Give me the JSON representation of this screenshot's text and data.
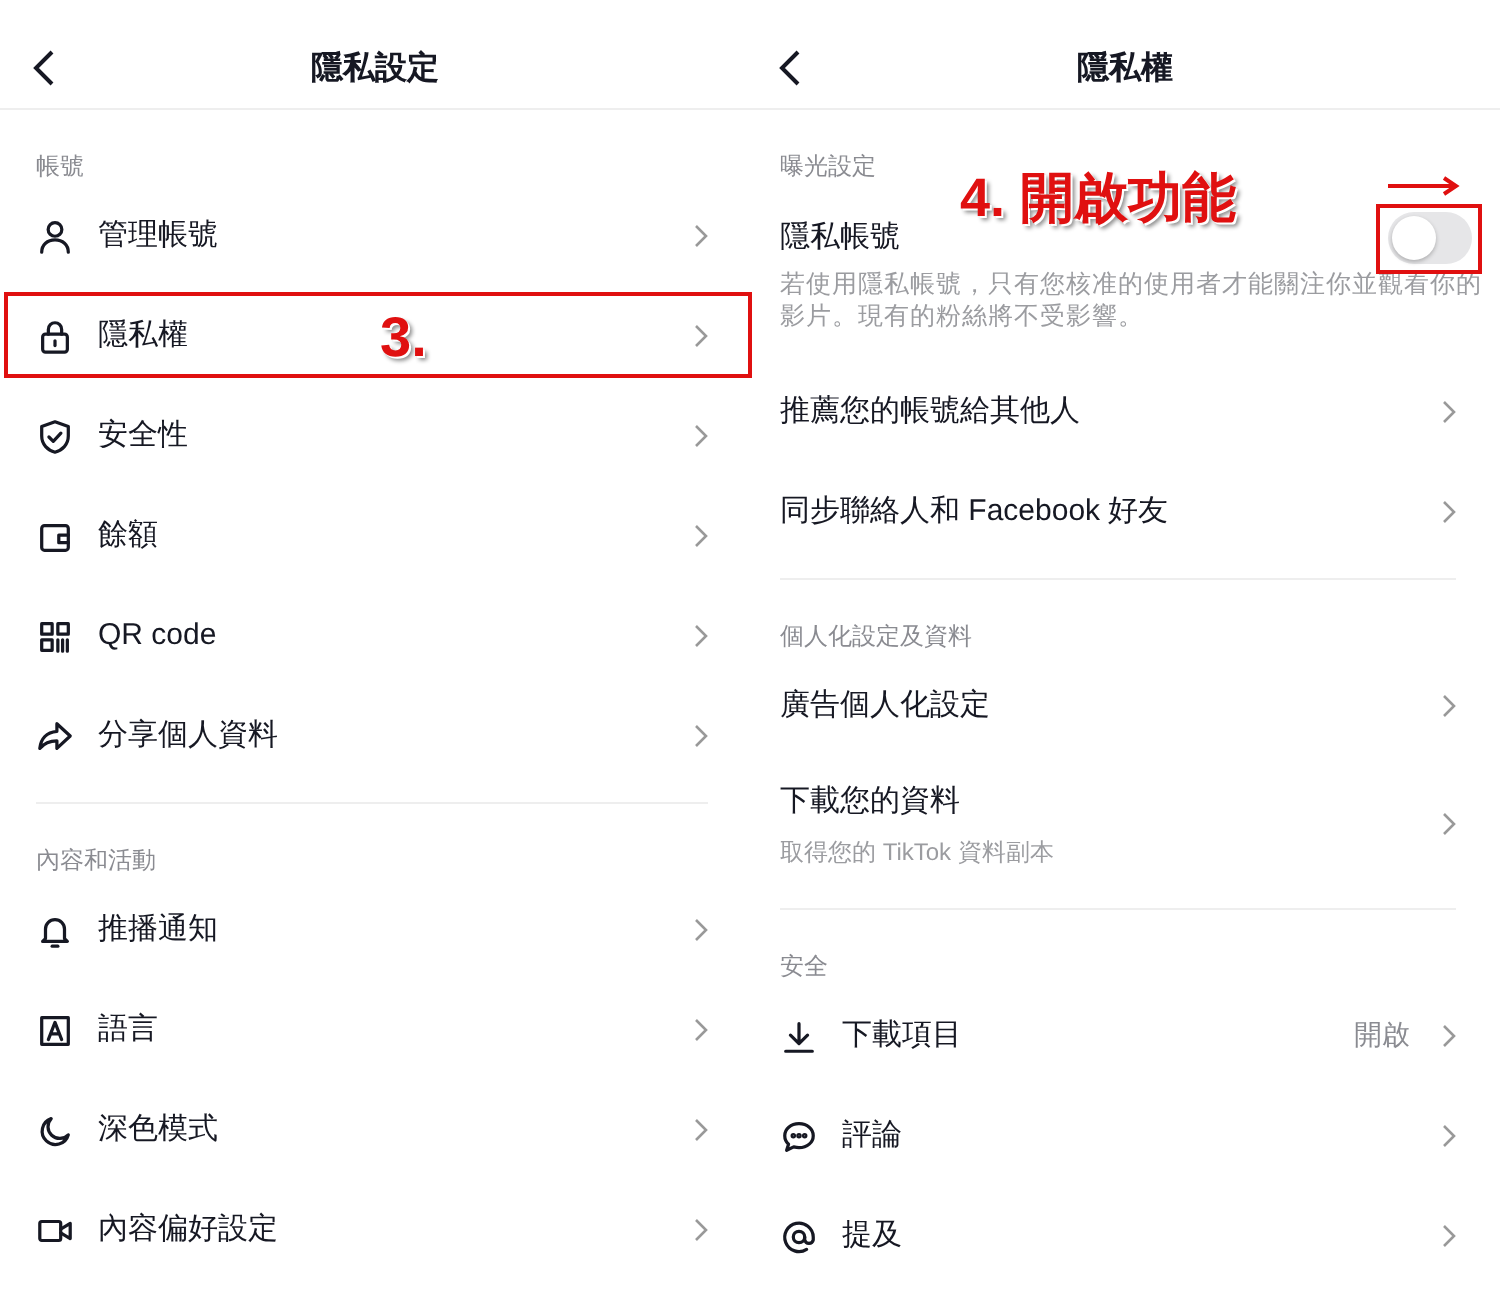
{
  "screens": [
    {
      "title": "隱私設定",
      "sections": [
        {
          "label": "帳號",
          "items": [
            {
              "kind": "link",
              "title": "管理帳號",
              "highlighted": false
            },
            {
              "kind": "link",
              "title": "隱私權",
              "highlighted": true,
              "annotation": "3."
            },
            {
              "kind": "link",
              "title": "安全性",
              "highlighted": false
            },
            {
              "kind": "link",
              "title": "餘額",
              "highlighted": false
            },
            {
              "kind": "link",
              "title": "QR code",
              "highlighted": false
            },
            {
              "kind": "link",
              "title": "分享個人資料",
              "highlighted": false
            }
          ]
        },
        {
          "label": "內容和活動",
          "items": [
            {
              "kind": "link",
              "title": "推播通知",
              "highlighted": false
            },
            {
              "kind": "link",
              "title": "語言",
              "highlighted": false
            },
            {
              "kind": "link",
              "title": "深色模式",
              "highlighted": false
            },
            {
              "kind": "link",
              "title": "內容偏好設定",
              "highlighted": false
            }
          ]
        }
      ]
    },
    {
      "title": "隱私權",
      "sections": [
        {
          "label": "曝光設定",
          "items": [
            {
              "kind": "toggle",
              "title": "隱私帳號",
              "on": false,
              "highlighted": true,
              "annotation": "4. 開啟功能",
              "description": "若使用隱私帳號，只有您核准的使用者才能關注你並觀看你的影片。現有的粉絲將不受影響。"
            },
            {
              "kind": "link",
              "title": "推薦您的帳號給其他人",
              "highlighted": false
            },
            {
              "kind": "link",
              "title": "同步聯絡人和 Facebook 好友",
              "highlighted": false
            }
          ]
        },
        {
          "label": "個人化設定及資料",
          "items": [
            {
              "kind": "link",
              "title": "廣告個人化設定",
              "highlighted": false
            },
            {
              "kind": "link",
              "title": "下載您的資料",
              "description": "取得您的 TikTok 資料副本",
              "highlighted": false
            }
          ]
        },
        {
          "label": "安全",
          "items": [
            {
              "kind": "link",
              "title": "下載項目",
              "value": "開啟",
              "highlighted": false
            },
            {
              "kind": "link",
              "title": "評論",
              "highlighted": false
            },
            {
              "kind": "link",
              "title": "提及",
              "highlighted": false
            }
          ]
        }
      ]
    }
  ]
}
